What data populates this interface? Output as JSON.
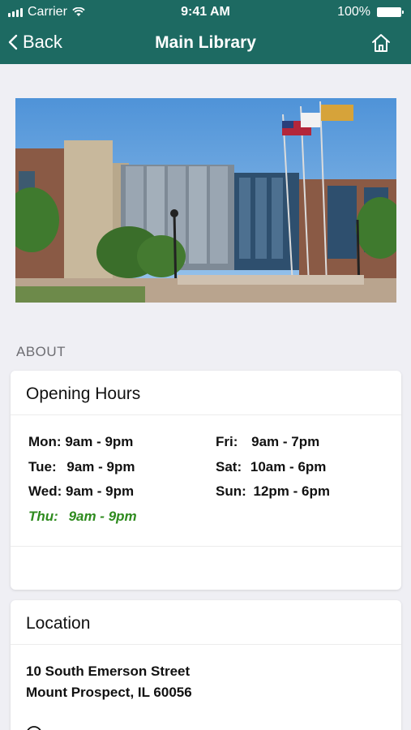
{
  "status_bar": {
    "carrier": "Carrier",
    "time": "9:41 AM",
    "battery": "100%"
  },
  "nav": {
    "back_label": "Back",
    "title": "Main Library"
  },
  "photo": {
    "icon": "building-photo"
  },
  "section": {
    "about": "ABOUT"
  },
  "hours": {
    "title": "Opening Hours",
    "left": [
      {
        "day": "Mon:",
        "time": "9am - 9pm"
      },
      {
        "day": "Tue:",
        "time": "9am - 9pm"
      },
      {
        "day": "Wed:",
        "time": "9am - 9pm"
      },
      {
        "day": "Thu:",
        "time": "9am - 9pm"
      }
    ],
    "right": [
      {
        "day": "Fri:",
        "time": "9am - 7pm"
      },
      {
        "day": "Sat:",
        "time": "10am - 6pm"
      },
      {
        "day": "Sun:",
        "time": "12pm - 6pm"
      }
    ],
    "today_color": "#2e8b1e"
  },
  "location": {
    "title": "Location",
    "address_line1": "10 South Emerson Street",
    "address_line2": "Mount Prospect, IL 60056"
  },
  "colors": {
    "header": "#1d6a62",
    "background": "#efeff4"
  }
}
